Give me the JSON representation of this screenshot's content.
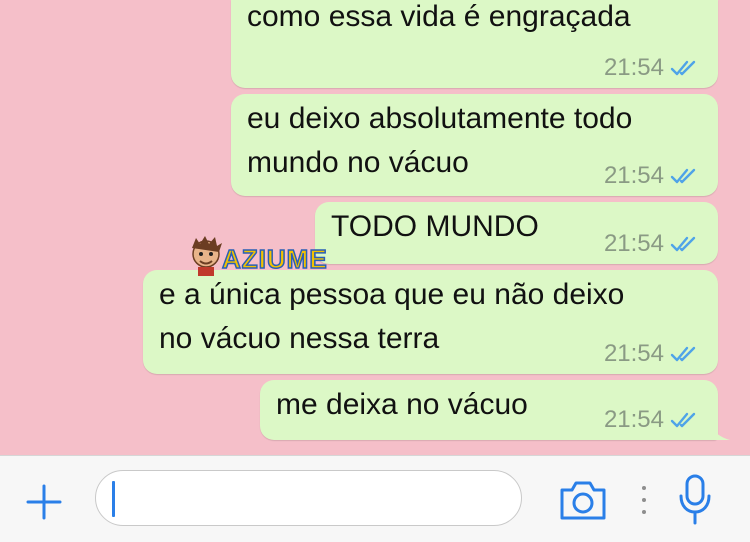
{
  "messages": [
    {
      "text": "como essa vida é engraçada",
      "time": "21:54",
      "status": "read"
    },
    {
      "text": "eu deixo absolutamente todo\nmundo no vácuo",
      "time": "21:54",
      "status": "read"
    },
    {
      "text": "TODO MUNDO",
      "time": "21:54",
      "status": "read"
    },
    {
      "text": "e a única pessoa que eu não deixo\nno vácuo nessa terra",
      "time": "21:54",
      "status": "read"
    },
    {
      "text": "me deixa no vácuo",
      "time": "21:54",
      "status": "read"
    }
  ],
  "watermark": {
    "text": "AZIUME"
  },
  "input_bar": {
    "message_input": {
      "value": "",
      "placeholder": ""
    },
    "icons": [
      "plus-icon",
      "camera-icon",
      "more-dots-icon",
      "microphone-icon"
    ]
  },
  "colors": {
    "background": "#f5bfc9",
    "outgoing_bubble": "#dcf8c6",
    "read_ticks": "#4fa3e8",
    "accent": "#2a7fe8"
  }
}
